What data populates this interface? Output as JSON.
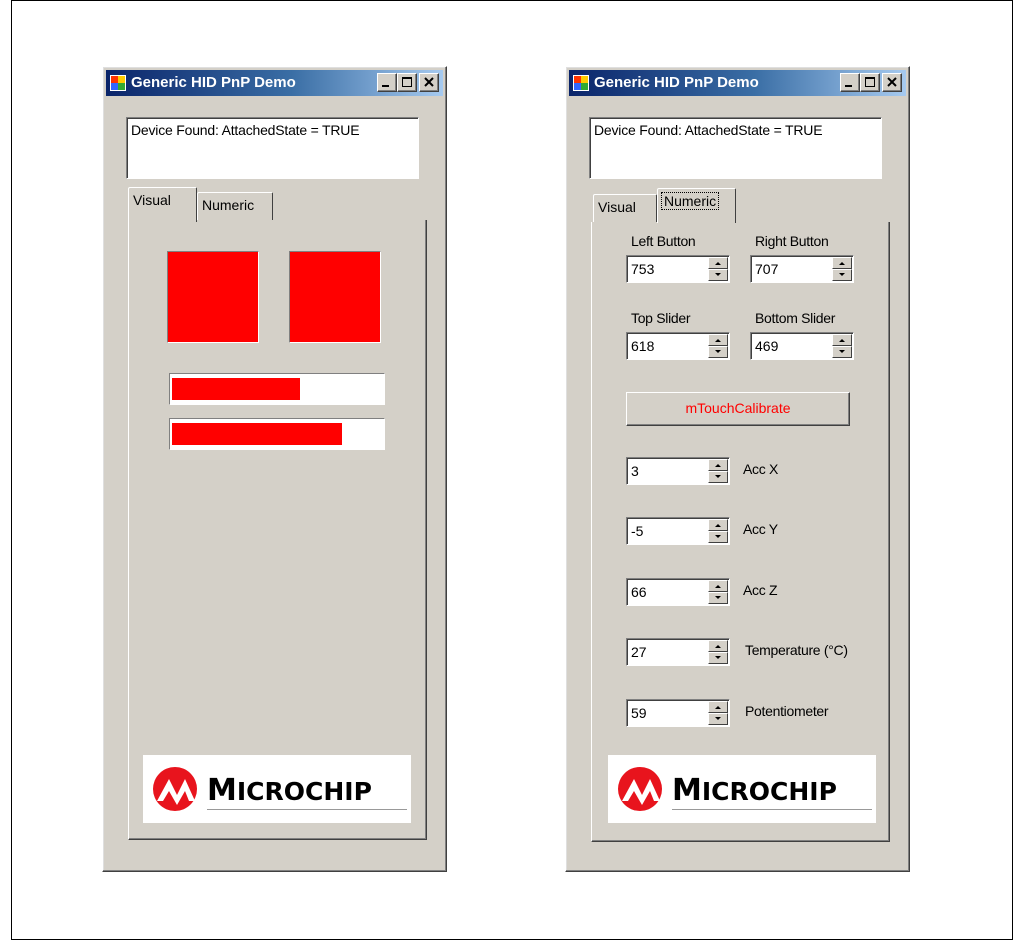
{
  "window": {
    "title": "Generic HID PnP Demo",
    "status": "Device Found: AttachedState = TRUE"
  },
  "tabs": {
    "visual": "Visual",
    "numeric": "Numeric"
  },
  "visual": {
    "top_slider_fraction": 0.61,
    "bottom_slider_fraction": 0.81,
    "indicator_color": "#ff0000"
  },
  "numeric": {
    "left_button": {
      "label": "Left Button",
      "value": "753"
    },
    "right_button": {
      "label": "Right Button",
      "value": "707"
    },
    "top_slider": {
      "label": "Top Slider",
      "value": "618"
    },
    "bottom_slider": {
      "label": "Bottom Slider",
      "value": "469"
    },
    "calibrate_label": "mTouchCalibrate",
    "acc_x": {
      "label": "Acc X",
      "value": "3"
    },
    "acc_y": {
      "label": "Acc Y",
      "value": "-5"
    },
    "acc_z": {
      "label": "Acc Z",
      "value": "66"
    },
    "temperature": {
      "label": "Temperature (°C)",
      "value": "27"
    },
    "potentiometer": {
      "label": "Potentiometer",
      "value": "59"
    }
  },
  "logo": {
    "brand": "MICROCHIP",
    "first_letter": "M",
    "rest": "ICROCHIP",
    "color": "#e8141d"
  }
}
